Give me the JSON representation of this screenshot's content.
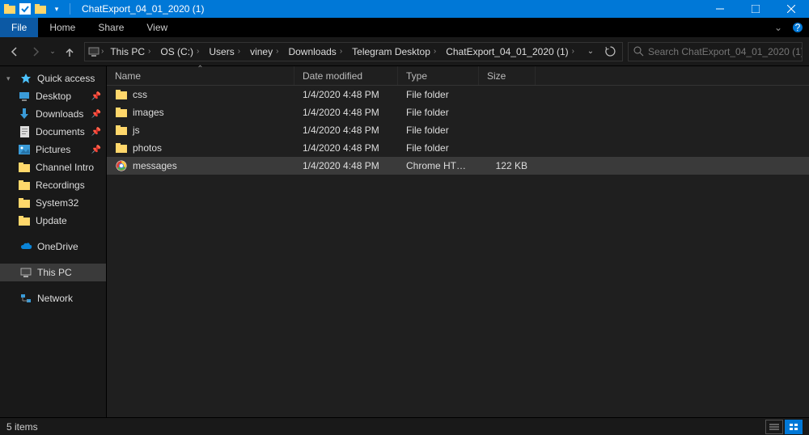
{
  "title": "ChatExport_04_01_2020 (1)",
  "ribbon": {
    "file": "File",
    "home": "Home",
    "share": "Share",
    "view": "View"
  },
  "breadcrumbs": [
    "This PC",
    "OS (C:)",
    "Users",
    "viney",
    "Downloads",
    "Telegram Desktop",
    "ChatExport_04_01_2020 (1)"
  ],
  "search": {
    "placeholder": "Search ChatExport_04_01_2020 (1)"
  },
  "sidebar": {
    "quick_access": "Quick access",
    "items": [
      {
        "label": "Desktop",
        "icon": "desktop",
        "pinned": true
      },
      {
        "label": "Downloads",
        "icon": "downloads",
        "pinned": true
      },
      {
        "label": "Documents",
        "icon": "documents",
        "pinned": true
      },
      {
        "label": "Pictures",
        "icon": "pictures",
        "pinned": true
      },
      {
        "label": "Channel Intro",
        "icon": "folder",
        "pinned": false
      },
      {
        "label": "Recordings",
        "icon": "folder",
        "pinned": false
      },
      {
        "label": "System32",
        "icon": "folder",
        "pinned": false
      },
      {
        "label": "Update",
        "icon": "folder",
        "pinned": false
      }
    ],
    "onedrive": "OneDrive",
    "this_pc": "This PC",
    "network": "Network"
  },
  "columns": {
    "name": "Name",
    "date": "Date modified",
    "type": "Type",
    "size": "Size"
  },
  "rows": [
    {
      "name": "css",
      "date": "1/4/2020 4:48 PM",
      "type": "File folder",
      "size": "",
      "icon": "folder",
      "selected": false
    },
    {
      "name": "images",
      "date": "1/4/2020 4:48 PM",
      "type": "File folder",
      "size": "",
      "icon": "folder",
      "selected": false
    },
    {
      "name": "js",
      "date": "1/4/2020 4:48 PM",
      "type": "File folder",
      "size": "",
      "icon": "folder",
      "selected": false
    },
    {
      "name": "photos",
      "date": "1/4/2020 4:48 PM",
      "type": "File folder",
      "size": "",
      "icon": "folder",
      "selected": false
    },
    {
      "name": "messages",
      "date": "1/4/2020 4:48 PM",
      "type": "Chrome HTML Docu...",
      "size": "122 KB",
      "icon": "chrome",
      "selected": true
    }
  ],
  "status": {
    "text": "5 items"
  }
}
